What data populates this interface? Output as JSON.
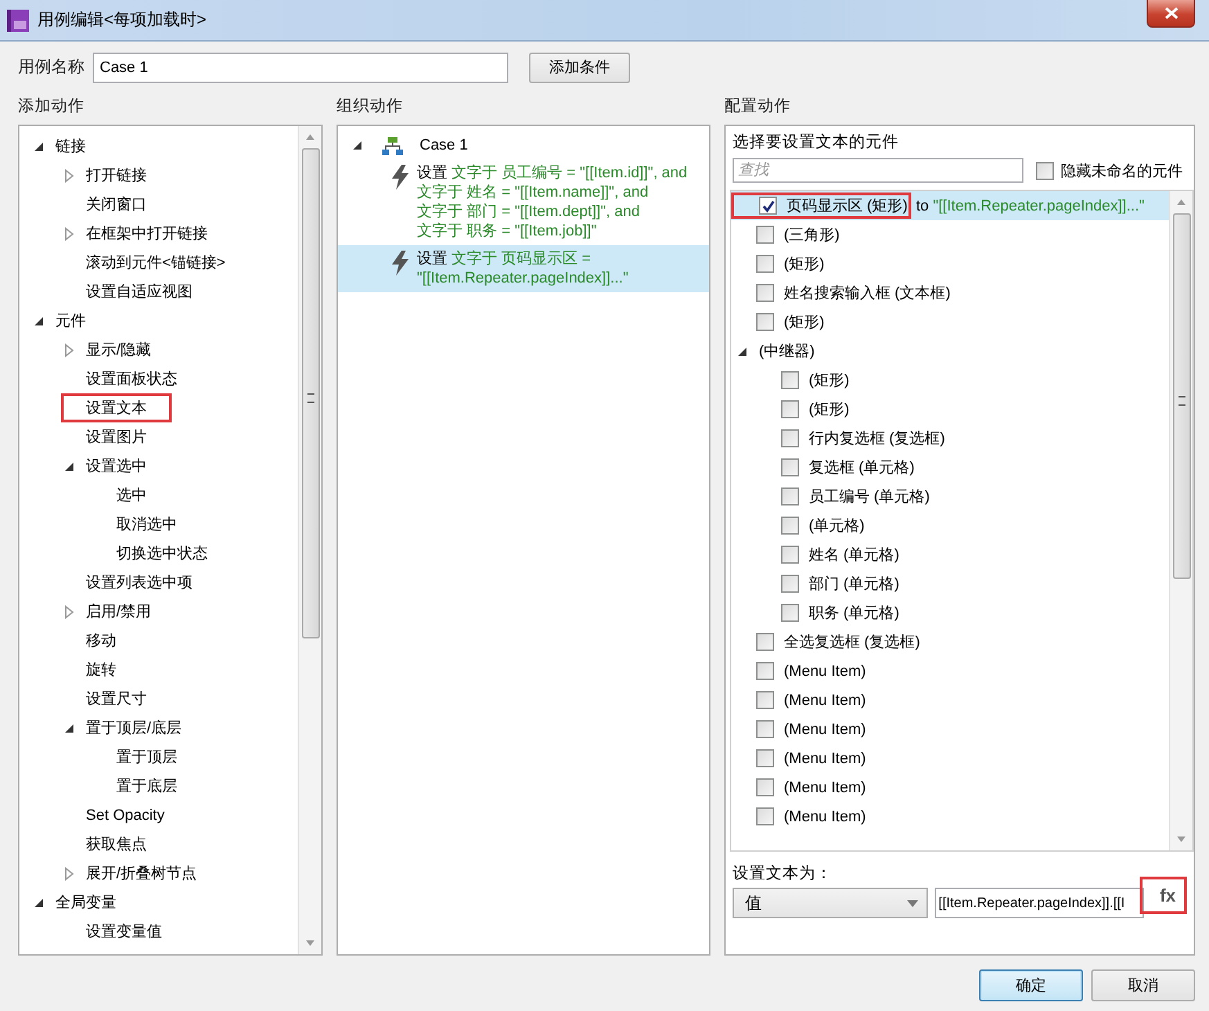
{
  "window": {
    "title": "用例编辑<每项加载时>"
  },
  "case_name": {
    "label": "用例名称",
    "value": "Case 1"
  },
  "add_condition_button": "添加条件",
  "add_actions": {
    "heading": "添加动作",
    "tree": [
      {
        "label": "链接",
        "expanded": true,
        "children": [
          {
            "label": "打开链接",
            "expanded": false
          },
          {
            "label": "关闭窗口"
          },
          {
            "label": "在框架中打开链接",
            "expanded": false
          },
          {
            "label": "滚动到元件<锚链接>"
          },
          {
            "label": "设置自适应视图"
          }
        ]
      },
      {
        "label": "元件",
        "expanded": true,
        "children": [
          {
            "label": "显示/隐藏",
            "expanded": false
          },
          {
            "label": "设置面板状态"
          },
          {
            "label": "设置文本",
            "annotated": true
          },
          {
            "label": "设置图片"
          },
          {
            "label": "设置选中",
            "expanded": true,
            "children": [
              {
                "label": "选中"
              },
              {
                "label": "取消选中"
              },
              {
                "label": "切换选中状态"
              }
            ]
          },
          {
            "label": "设置列表选中项"
          },
          {
            "label": "启用/禁用",
            "expanded": false
          },
          {
            "label": "移动"
          },
          {
            "label": "旋转"
          },
          {
            "label": "设置尺寸"
          },
          {
            "label": "置于顶层/底层",
            "expanded": true,
            "children": [
              {
                "label": "置于顶层"
              },
              {
                "label": "置于底层"
              }
            ]
          },
          {
            "label": "Set Opacity"
          },
          {
            "label": "获取焦点"
          },
          {
            "label": "展开/折叠树节点",
            "expanded": false
          }
        ]
      },
      {
        "label": "全局变量",
        "expanded": true,
        "children": [
          {
            "label": "设置变量值"
          }
        ]
      }
    ]
  },
  "organize_actions": {
    "heading": "组织动作",
    "case": {
      "label": "Case 1",
      "expanded": true,
      "actions": [
        {
          "verb": "设置",
          "lines": [
            "文字于 员工编号 = \"[[Item.id]]\", and",
            "文字于 姓名 = \"[[Item.name]]\", and",
            "文字于 部门 = \"[[Item.dept]]\", and",
            "文字于 职务 = \"[[Item.job]]\""
          ],
          "selected": false
        },
        {
          "verb": "设置",
          "lines": [
            "文字于 页码显示区 =",
            "\"[[Item.Repeater.pageIndex]]...\""
          ],
          "selected": true
        }
      ]
    }
  },
  "configure_action": {
    "heading": "配置动作",
    "prompt": "选择要设置文本的元件",
    "search": {
      "placeholder": "查找"
    },
    "hide_unnamed": {
      "label": "隐藏未命名的元件",
      "checked": false
    },
    "widgets": [
      {
        "label": "页码显示区 (矩形)",
        "connector": "to",
        "value": "\"[[Item.Repeater.pageIndex]]...\"",
        "checked": true,
        "selected": true,
        "annotated": true
      },
      {
        "label": "(三角形)",
        "checked": false,
        "selected": false
      },
      {
        "label": "(矩形)",
        "checked": false,
        "selected": false
      },
      {
        "label": "姓名搜索输入框 (文本框)",
        "checked": false,
        "selected": false
      },
      {
        "label": "(矩形)",
        "checked": false,
        "selected": false
      },
      {
        "label": "(中继器)",
        "expanded": true,
        "selected": false,
        "children": [
          {
            "label": "(矩形)",
            "checked": false,
            "selected": false
          },
          {
            "label": "(矩形)",
            "checked": false,
            "selected": false
          },
          {
            "label": "行内复选框 (复选框)",
            "checked": false,
            "selected": false
          },
          {
            "label": "复选框 (单元格)",
            "checked": false,
            "selected": false
          },
          {
            "label": "员工编号 (单元格)",
            "checked": false,
            "selected": false
          },
          {
            "label": "(单元格)",
            "checked": false,
            "selected": false
          },
          {
            "label": "姓名 (单元格)",
            "checked": false,
            "selected": false
          },
          {
            "label": "部门 (单元格)",
            "checked": false,
            "selected": false
          },
          {
            "label": "职务 (单元格)",
            "checked": false,
            "selected": false
          }
        ]
      },
      {
        "label": "全选复选框 (复选框)",
        "checked": false,
        "selected": false
      },
      {
        "label": "(Menu Item)",
        "checked": false,
        "selected": false
      },
      {
        "label": "(Menu Item)",
        "checked": false,
        "selected": false
      },
      {
        "label": "(Menu Item)",
        "checked": false,
        "selected": false
      },
      {
        "label": "(Menu Item)",
        "checked": false,
        "selected": false
      },
      {
        "label": "(Menu Item)",
        "checked": false,
        "selected": false
      },
      {
        "label": "(Menu Item)",
        "checked": false,
        "selected": false
      }
    ],
    "set_text_label": "设置文本为：",
    "value_type": "值",
    "value_input": "[[Item.Repeater.pageIndex]].[[I",
    "fx_button": {
      "label": "fx",
      "annotated": true
    }
  },
  "buttons": [
    {
      "label": "确定",
      "kind": "primary"
    },
    {
      "label": "取消",
      "kind": "default"
    }
  ]
}
